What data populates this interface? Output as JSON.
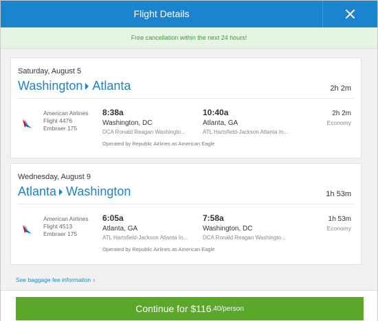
{
  "header": {
    "title": "Flight Details"
  },
  "banner": {
    "text": "Free cancellation within the next 24 hours!"
  },
  "trips": [
    {
      "date": "Saturday, August 5",
      "origin": "Washington",
      "destination": "Atlanta",
      "duration": "2h 2m",
      "segment": {
        "airline": "American Airlines",
        "flight": "Flight 4476",
        "aircraft": "Embraer 175",
        "dep_time": "8:38a",
        "dep_city": "Washington, DC",
        "dep_airport": "DCA Ronald Reagan Washingto...",
        "arr_time": "10:40a",
        "arr_city": "Atlanta, GA",
        "arr_airport": "ATL Hartsfield-Jackson Atlanta In...",
        "operated_by": "Operated by Republic Airlines as American Eagle",
        "duration": "2h 2m",
        "cabin": "Economy"
      }
    },
    {
      "date": "Wednesday, August 9",
      "origin": "Atlanta",
      "destination": "Washington",
      "duration": "1h 53m",
      "segment": {
        "airline": "American Airlines",
        "flight": "Flight 4513",
        "aircraft": "Embraer 175",
        "dep_time": "6:05a",
        "dep_city": "Atlanta, GA",
        "dep_airport": "ATL Hartsfield-Jackson Atlanta In...",
        "arr_time": "7:58a",
        "arr_city": "Washington, DC",
        "arr_airport": "DCA Ronald Reagan Washingto...",
        "operated_by": "Operated by Republic Airlines as American Eagle",
        "duration": "1h 53m",
        "cabin": "Economy"
      }
    }
  ],
  "baggage_link": "See baggage fee information",
  "continue": {
    "label": "Continue for $116",
    "cents": ".40/person"
  },
  "colors": {
    "header": "#1a84cf",
    "accent": "#1a84cf",
    "banner_text": "#3c9a3a",
    "button": "#5aa72a"
  },
  "icons": {
    "close": "close-icon",
    "airline_logo": "american-airlines-logo",
    "baggage_chevron": "chevron-right-icon"
  }
}
